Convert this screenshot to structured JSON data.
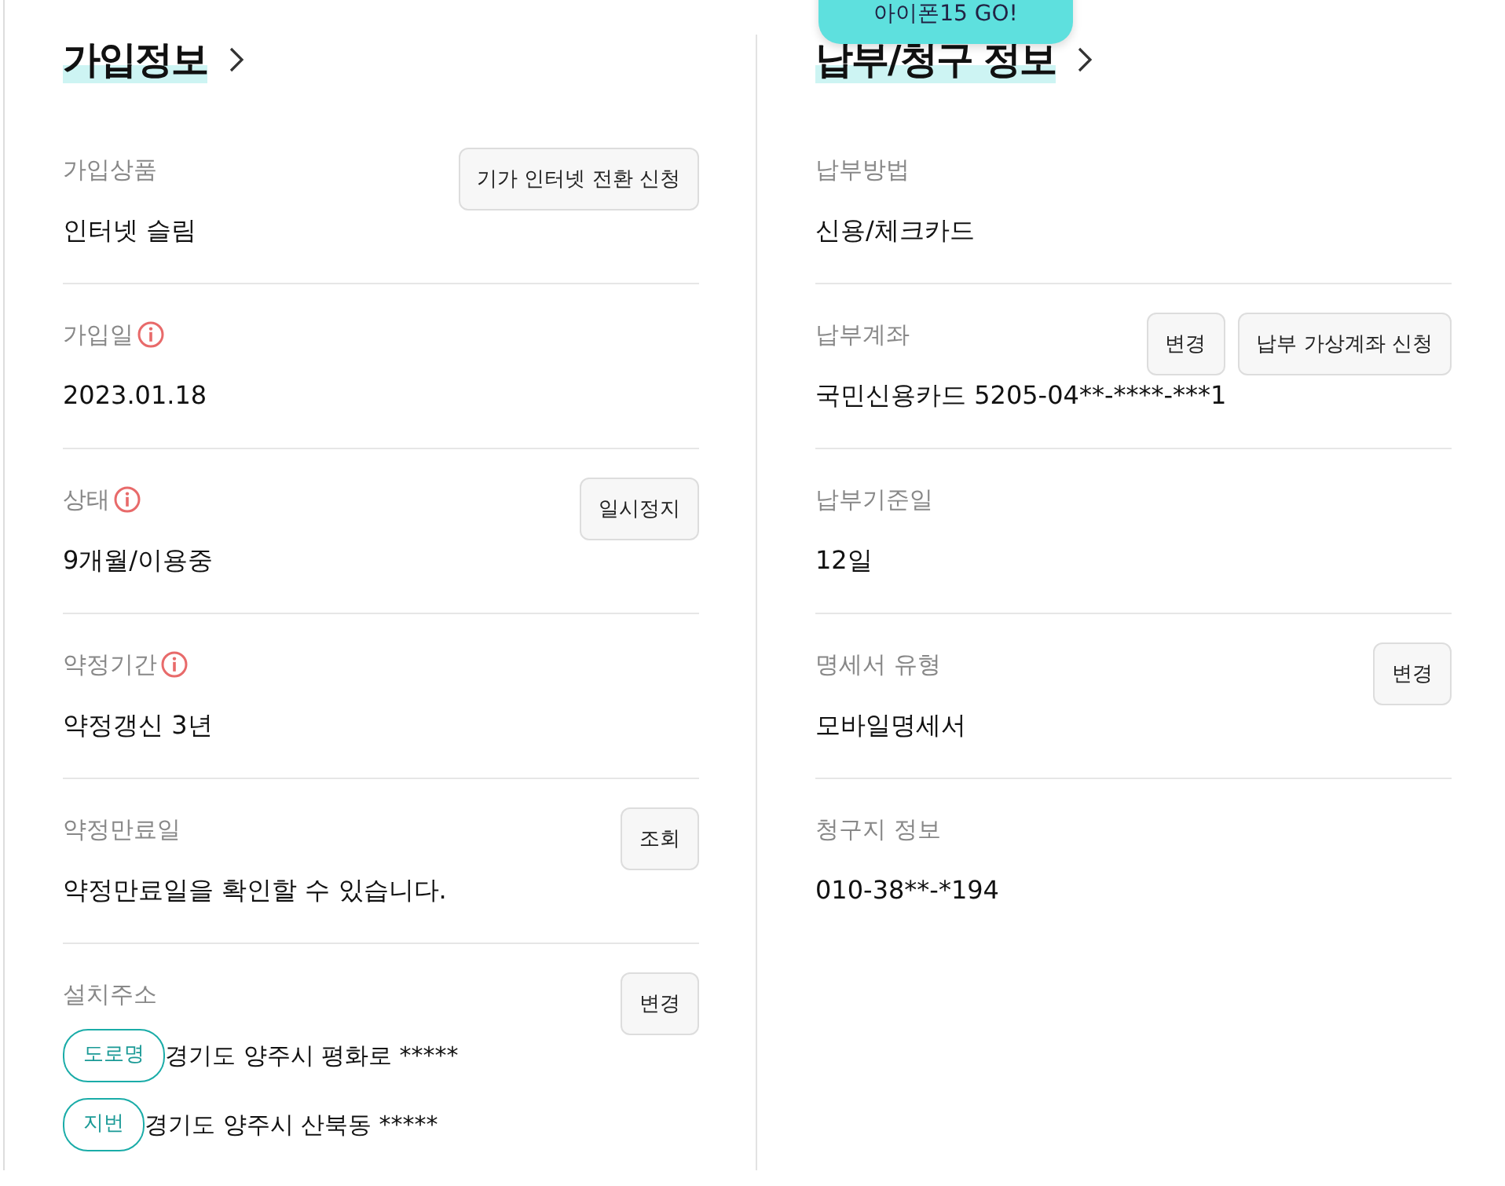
{
  "promo": {
    "text": "아이폰15 GO!"
  },
  "sections": [
    {
      "title": "가입정보",
      "rows": [
        {
          "label": "가입상품",
          "info": false,
          "buttons": [
            "기가 인터넷 전환 신청"
          ],
          "value": "인터넷 슬림"
        },
        {
          "label": "가입일",
          "info": true,
          "value": "2023.01.18"
        },
        {
          "label": "상태",
          "info": true,
          "buttons": [
            "일시정지"
          ],
          "value": "9개월/이용중"
        },
        {
          "label": "약정기간",
          "info": true,
          "value": "약정갱신 3년"
        },
        {
          "label": "약정만료일",
          "info": false,
          "buttons": [
            "조회"
          ],
          "value": "약정만료일을 확인할 수 있습니다."
        },
        {
          "label": "설치주소",
          "info": false,
          "buttons": [
            "변경"
          ],
          "addresses": [
            {
              "tag": "도로명",
              "text": "경기도 양주시 평화로 *****"
            },
            {
              "tag": "지번",
              "text": "경기도 양주시 산북동 *****"
            }
          ]
        }
      ]
    },
    {
      "title": "납부/청구 정보",
      "rows": [
        {
          "label": "납부방법",
          "info": false,
          "value": "신용/체크카드"
        },
        {
          "label": "납부계좌",
          "info": false,
          "buttons": [
            "변경",
            "납부 가상계좌 신청"
          ],
          "value": "국민신용카드 5205-04**-****-***1"
        },
        {
          "label": "납부기준일",
          "info": false,
          "value": "12일"
        },
        {
          "label": "명세서 유형",
          "info": false,
          "buttons": [
            "변경"
          ],
          "value": "모바일명세서"
        },
        {
          "label": "청구지 정보",
          "info": false,
          "value": "010-38**-*194"
        }
      ]
    }
  ]
}
